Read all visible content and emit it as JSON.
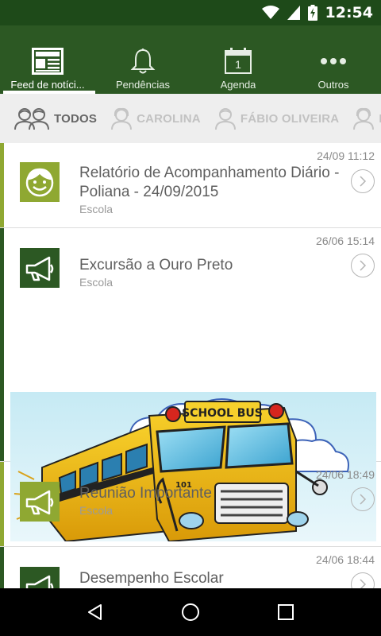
{
  "status_bar": {
    "time": "12:54"
  },
  "nav": {
    "tabs": [
      {
        "label": "Feed de notíci...",
        "icon": "newspaper-icon",
        "active": true
      },
      {
        "label": "Pendências",
        "icon": "bell-icon",
        "active": false
      },
      {
        "label": "Agenda",
        "icon": "calendar-icon",
        "calendar_day": "1",
        "active": false
      },
      {
        "label": "Outros",
        "icon": "more-dots-icon",
        "active": false
      }
    ]
  },
  "filters": [
    {
      "label": "TODOS",
      "icon": "people-group-icon",
      "active": true
    },
    {
      "label": "CAROLINA",
      "icon": "person-female-icon",
      "active": false
    },
    {
      "label": "FÁBIO OLIVEIRA",
      "icon": "person-male-icon",
      "active": false
    },
    {
      "label": "PC",
      "icon": "person-female-icon",
      "active": false
    }
  ],
  "feed": {
    "items": [
      {
        "time": "24/09 11:12",
        "title": "Relatório de Acompanhamento Diário - Poliana  - 24/09/2015",
        "subtitle": "Escola",
        "icon": "smiley-face-icon",
        "accent_color": "#8fa832"
      },
      {
        "time": "26/06 15:14",
        "title": "Excursão a Ouro Preto",
        "subtitle": "Escola",
        "icon": "megaphone-icon",
        "accent_color": "#2c5823",
        "image": "school-bus-illustration",
        "image_text": "SCHOOL BUS",
        "image_number": "101"
      },
      {
        "time": "24/06 18:49",
        "title": "Reunião Importante",
        "subtitle": "Escola",
        "icon": "megaphone-icon",
        "accent_color": "#8fa832"
      },
      {
        "time": "24/06 18:44",
        "title": "Desempenho Escolar",
        "subtitle": "",
        "icon": "megaphone-icon",
        "accent_color": "#2c5823"
      }
    ]
  },
  "colors": {
    "status_bar": "#1e4a19",
    "top_nav": "#2c5823",
    "avatar_light": "#8fa832",
    "avatar_dark": "#2c5823",
    "filter_bg": "#eeeeee"
  },
  "system_nav": {
    "buttons": [
      "back-icon",
      "home-icon",
      "recents-icon"
    ]
  }
}
